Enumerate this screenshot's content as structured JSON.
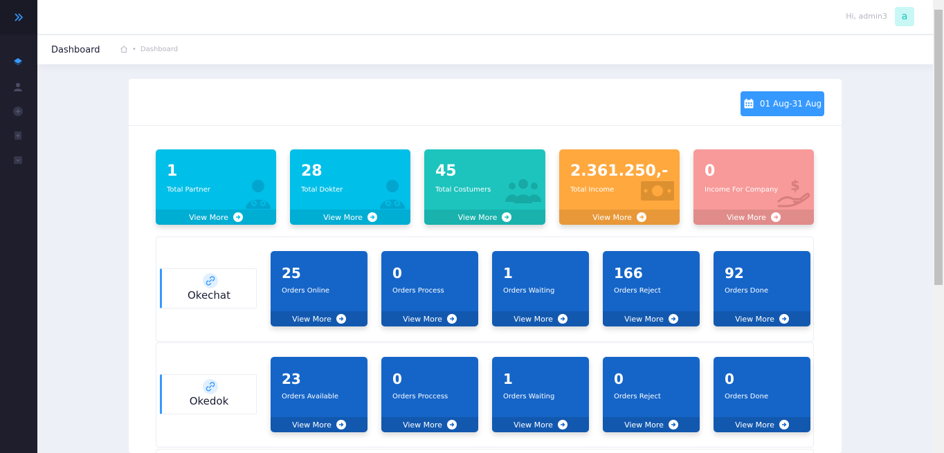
{
  "header": {
    "greeting": "Hi, admin3",
    "avatar_letter": "a"
  },
  "subheader": {
    "title": "Dashboard",
    "breadcrumb": "Dashboard"
  },
  "date_range": "01 Aug-31 Aug",
  "stats": [
    {
      "value": "1",
      "label": "Total Partner",
      "more": "View More",
      "color": "#00bfe8",
      "icon": "doctor-icon"
    },
    {
      "value": "28",
      "label": "Total Dokter",
      "more": "View More",
      "color": "#00bfe8",
      "icon": "doctor-icon"
    },
    {
      "value": "45",
      "label": "Total Costumers",
      "more": "View More",
      "color": "#1cc4bd",
      "icon": "users-icon"
    },
    {
      "value": "2.361.250,-",
      "label": "Total Income",
      "more": "View More",
      "color": "#ffa83e",
      "icon": "money-icon"
    },
    {
      "value": "0",
      "label": "Income For Company",
      "more": "View More",
      "color": "#f79a99",
      "icon": "hand-dollar-icon"
    }
  ],
  "sections": [
    {
      "name": "Okechat",
      "orders": [
        {
          "value": "25",
          "label": "Orders Online",
          "more": "View More"
        },
        {
          "value": "0",
          "label": "Orders Process",
          "more": "View More"
        },
        {
          "value": "1",
          "label": "Orders Waiting",
          "more": "View More"
        },
        {
          "value": "166",
          "label": "Orders Reject",
          "more": "View More"
        },
        {
          "value": "92",
          "label": "Orders Done",
          "more": "View More"
        }
      ]
    },
    {
      "name": "Okedok",
      "orders": [
        {
          "value": "23",
          "label": "Orders Available",
          "more": "View More"
        },
        {
          "value": "0",
          "label": "Orders Proccess",
          "more": "View More"
        },
        {
          "value": "1",
          "label": "Orders Waiting",
          "more": "View More"
        },
        {
          "value": "0",
          "label": "Orders Reject",
          "more": "View More"
        },
        {
          "value": "0",
          "label": "Orders Done",
          "more": "View More"
        }
      ]
    }
  ]
}
